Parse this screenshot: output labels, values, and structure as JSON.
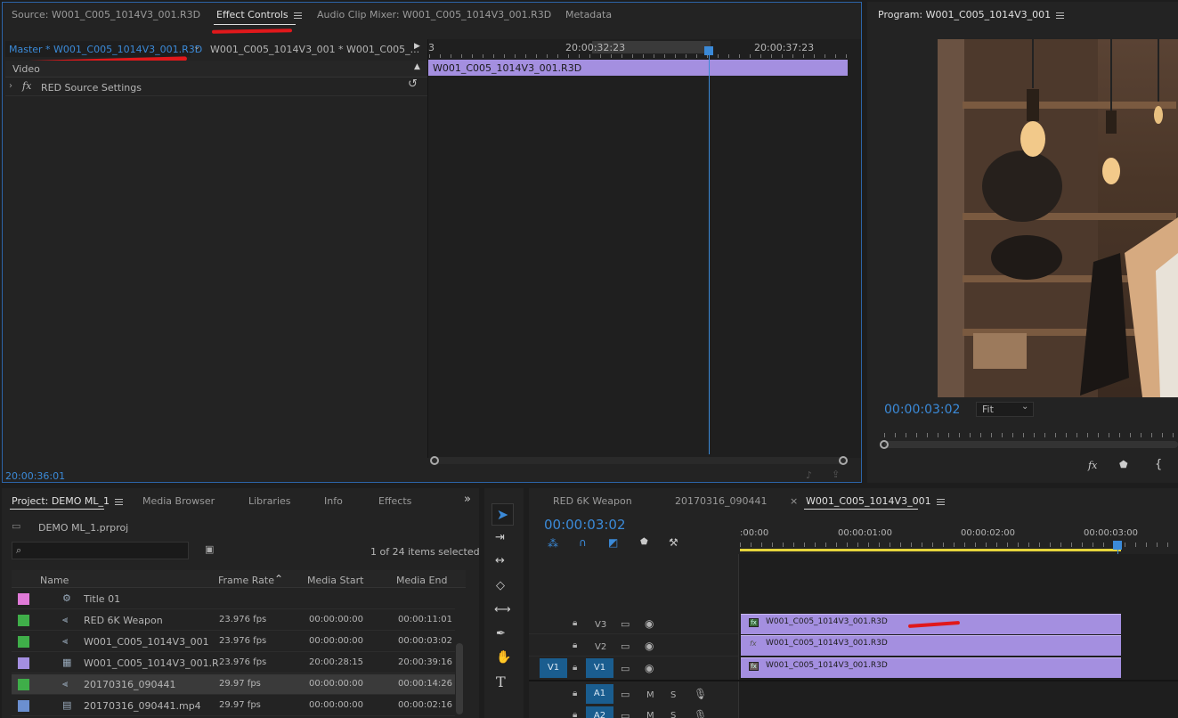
{
  "source_panel": {
    "tabs": [
      "Source: W001_C005_1014V3_001.R3D",
      "Effect Controls",
      "Audio Clip Mixer: W001_C005_1014V3_001.R3D",
      "Metadata"
    ],
    "master_clip": "Master * W001_C005_1014V3_001.R3D",
    "sequence_clip": "W001_C005_1014V3_001 * W001_C005_...",
    "video_label": "Video",
    "effect_row": "RED Source Settings",
    "fx_glyph": "fx",
    "ruler_left": "3",
    "ruler_mid": "20:00:32:23",
    "ruler_right": "20:00:37:23",
    "clip_name": "W001_C005_1014V3_001.R3D",
    "timecode": "20:00:36:01"
  },
  "program_panel": {
    "title": "Program: W001_C005_1014V3_001",
    "timecode": "00:00:03:02",
    "zoom": "Fit",
    "fx_glyph": "fx"
  },
  "project_panel": {
    "tabs": [
      "Project: DEMO ML_1",
      "Media Browser",
      "Libraries",
      "Info",
      "Effects"
    ],
    "project_file": "DEMO ML_1.prproj",
    "items_selected": "1 of 24 items selected",
    "columns": [
      "Name",
      "Frame Rate",
      "Media Start",
      "Media End"
    ],
    "rows": [
      {
        "name": "Title 01",
        "rate": "",
        "start": "",
        "end": "",
        "color": "#e07ad8"
      },
      {
        "name": "RED 6K Weapon",
        "rate": "23.976 fps",
        "start": "00:00:00:00",
        "end": "00:00:11:01",
        "color": "#3fae49"
      },
      {
        "name": "W001_C005_1014V3_001",
        "rate": "23.976 fps",
        "start": "00:00:00:00",
        "end": "00:00:03:02",
        "color": "#3fae49"
      },
      {
        "name": "W001_C005_1014V3_001.R",
        "rate": "23.976 fps",
        "start": "20:00:28:15",
        "end": "20:00:39:16",
        "color": "#a48fe0"
      },
      {
        "name": "20170316_090441",
        "rate": "29.97 fps",
        "start": "00:00:00:00",
        "end": "00:00:14:26",
        "color": "#3fae49"
      },
      {
        "name": "20170316_090441.mp4",
        "rate": "29.97 fps",
        "start": "00:00:00:00",
        "end": "00:00:02:16",
        "color": "#6b8fd0"
      }
    ]
  },
  "timeline_panel": {
    "tabs": [
      "RED 6K Weapon",
      "20170316_090441",
      "W001_C005_1014V3_001"
    ],
    "close_glyph": "×",
    "timecode": "00:00:03:02",
    "ruler": [
      ":00:00",
      "00:00:01:00",
      "00:00:02:00",
      "00:00:03:00"
    ],
    "tracks": {
      "v3": "V3",
      "v2": "V2",
      "v1": "V1",
      "v1_src": "V1",
      "a1": "A1",
      "a2": "A2",
      "m": "M",
      "s": "S"
    },
    "clips": [
      "W001_C005_1014V3_001.R3D",
      "W001_C005_1014V3_001.R3D",
      "W001_C005_1014V3_001.R3D"
    ],
    "fx_glyph": "fx"
  }
}
